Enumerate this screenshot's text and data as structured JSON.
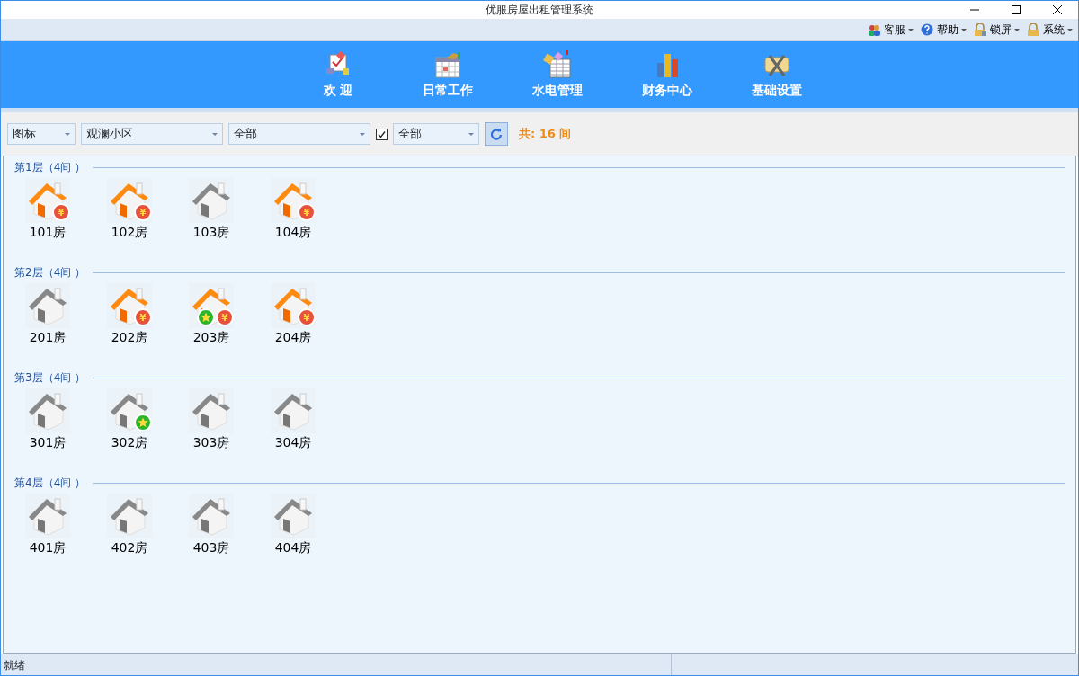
{
  "window": {
    "title": "优服房屋出租管理系统"
  },
  "menu": [
    {
      "label": "客服"
    },
    {
      "label": "帮助"
    },
    {
      "label": "锁屏"
    },
    {
      "label": "系统"
    }
  ],
  "nav": [
    {
      "label": "欢 迎"
    },
    {
      "label": "日常工作"
    },
    {
      "label": "水电管理"
    },
    {
      "label": "财务中心"
    },
    {
      "label": "基础设置"
    }
  ],
  "toolbar": {
    "view": "图标",
    "community": "观澜小区",
    "building": "全部",
    "filter_checked": true,
    "status": "全部",
    "total": "共: 16 间"
  },
  "floors": [
    {
      "title": "第1层（4间 ）",
      "rooms": [
        {
          "label": "101房",
          "rented": true,
          "badges": [
            {
              "kind": "yen",
              "symbol": "¥"
            }
          ]
        },
        {
          "label": "102房",
          "rented": true,
          "badges": [
            {
              "kind": "yen",
              "symbol": "¥"
            }
          ]
        },
        {
          "label": "103房",
          "rented": false
        },
        {
          "label": "104房",
          "rented": true,
          "badges": [
            {
              "kind": "yen",
              "symbol": "¥"
            }
          ]
        }
      ]
    },
    {
      "title": "第2层（4间 ）",
      "rooms": [
        {
          "label": "201房",
          "rented": false
        },
        {
          "label": "202房",
          "rented": true,
          "badges": [
            {
              "kind": "yen",
              "symbol": "¥"
            }
          ]
        },
        {
          "label": "203房",
          "rented": true,
          "badges": [
            {
              "kind": "star"
            },
            {
              "kind": "yen",
              "symbol": "¥"
            }
          ]
        },
        {
          "label": "204房",
          "rented": true,
          "badges": [
            {
              "kind": "yen",
              "symbol": "¥"
            }
          ]
        }
      ]
    },
    {
      "title": "第3层（4间 ）",
      "rooms": [
        {
          "label": "301房",
          "rented": false
        },
        {
          "label": "302房",
          "rented": false,
          "badges": [
            {
              "kind": "star"
            }
          ]
        },
        {
          "label": "303房",
          "rented": false
        },
        {
          "label": "304房",
          "rented": false
        }
      ]
    },
    {
      "title": "第4层（4间 ）",
      "rooms": [
        {
          "label": "401房",
          "rented": false
        },
        {
          "label": "402房",
          "rented": false
        },
        {
          "label": "403房",
          "rented": false
        },
        {
          "label": "404房",
          "rented": false
        }
      ]
    }
  ],
  "status_bar": {
    "text": "就绪"
  }
}
